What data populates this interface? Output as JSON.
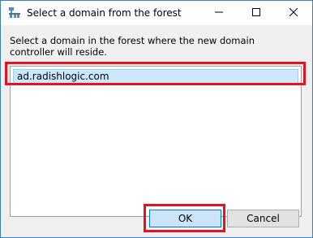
{
  "window": {
    "title": "Select a domain from the forest",
    "icon": "forest-domain-icon"
  },
  "titlebar_buttons": {
    "minimize_icon": "minimize-icon",
    "maximize_icon": "maximize-icon",
    "close_icon": "close-icon"
  },
  "dialog": {
    "instruction": "Select a domain in the forest where the new domain controller will reside.",
    "domains": [
      {
        "label": "ad.radishlogic.com",
        "selected": true
      }
    ]
  },
  "buttons": {
    "ok_label": "OK",
    "cancel_label": "Cancel"
  },
  "colors": {
    "highlight": "#e81123",
    "selection": "#cce8ff",
    "accent": "#0078d7"
  }
}
